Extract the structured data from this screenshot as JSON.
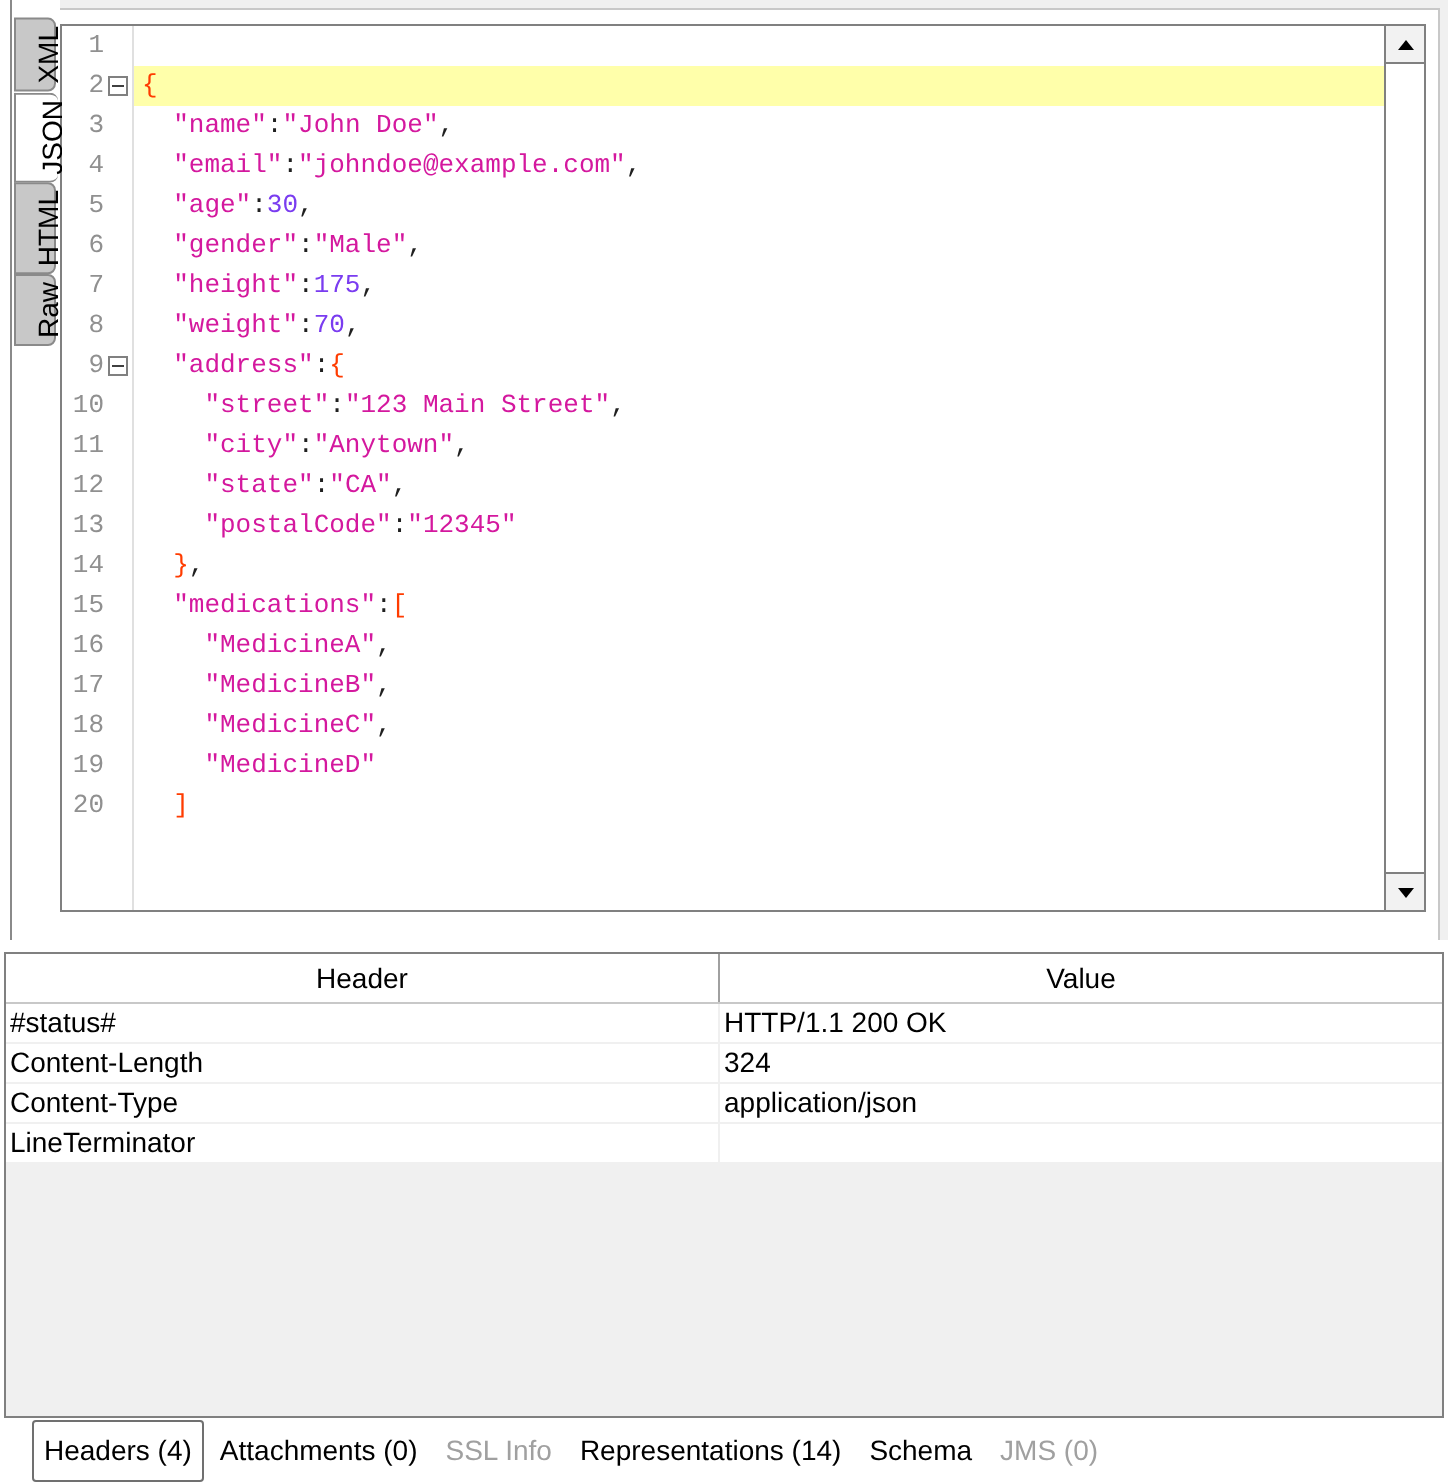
{
  "view_tabs": [
    {
      "label": "XML",
      "selected": false
    },
    {
      "label": "JSON",
      "selected": true
    },
    {
      "label": "HTML",
      "selected": false
    },
    {
      "label": "Raw",
      "selected": false
    }
  ],
  "editor": {
    "lines": [
      {
        "number": "1",
        "highlighted": false
      },
      {
        "number": "2",
        "highlighted": true,
        "expanded": true,
        "tokens": [
          {
            "kind": "brace",
            "text": "{"
          }
        ]
      },
      {
        "number": "3",
        "highlighted": false,
        "tokens": [
          {
            "kind": "string",
            "text": "  \"name\""
          },
          {
            "kind": "punct",
            "text": ":"
          },
          {
            "kind": "string",
            "text": "\"John Doe\""
          },
          {
            "kind": "punct",
            "text": ","
          }
        ]
      },
      {
        "number": "4",
        "highlighted": false,
        "tokens": [
          {
            "kind": "string",
            "text": "  \"email\""
          },
          {
            "kind": "punct",
            "text": ":"
          },
          {
            "kind": "string",
            "text": "\"johndoe@example.com\""
          },
          {
            "kind": "punct",
            "text": ","
          }
        ]
      },
      {
        "number": "5",
        "highlighted": false,
        "tokens": [
          {
            "kind": "string",
            "text": "  \"age\""
          },
          {
            "kind": "punct",
            "text": ":"
          },
          {
            "kind": "number",
            "text": "30"
          },
          {
            "kind": "punct",
            "text": ","
          }
        ]
      },
      {
        "number": "6",
        "highlighted": false,
        "tokens": [
          {
            "kind": "string",
            "text": "  \"gender\""
          },
          {
            "kind": "punct",
            "text": ":"
          },
          {
            "kind": "string",
            "text": "\"Male\""
          },
          {
            "kind": "punct",
            "text": ","
          }
        ]
      },
      {
        "number": "7",
        "highlighted": false,
        "tokens": [
          {
            "kind": "string",
            "text": "  \"height\""
          },
          {
            "kind": "punct",
            "text": ":"
          },
          {
            "kind": "number",
            "text": "175"
          },
          {
            "kind": "punct",
            "text": ","
          }
        ]
      },
      {
        "number": "8",
        "highlighted": false,
        "tokens": [
          {
            "kind": "string",
            "text": "  \"weight\""
          },
          {
            "kind": "punct",
            "text": ":"
          },
          {
            "kind": "number",
            "text": "70"
          },
          {
            "kind": "punct",
            "text": ","
          }
        ]
      },
      {
        "number": "9",
        "highlighted": false,
        "expanded": true,
        "tokens": [
          {
            "kind": "string",
            "text": "  \"address\""
          },
          {
            "kind": "punct",
            "text": ":"
          },
          {
            "kind": "brace",
            "text": "{"
          }
        ]
      },
      {
        "number": "10",
        "highlighted": false,
        "tokens": [
          {
            "kind": "string",
            "text": "    \"street\""
          },
          {
            "kind": "punct",
            "text": ":"
          },
          {
            "kind": "string",
            "text": "\"123 Main Street\""
          },
          {
            "kind": "punct",
            "text": ","
          }
        ]
      },
      {
        "number": "11",
        "highlighted": false,
        "tokens": [
          {
            "kind": "string",
            "text": "    \"city\""
          },
          {
            "kind": "punct",
            "text": ":"
          },
          {
            "kind": "string",
            "text": "\"Anytown\""
          },
          {
            "kind": "punct",
            "text": ","
          }
        ]
      },
      {
        "number": "12",
        "highlighted": false,
        "tokens": [
          {
            "kind": "string",
            "text": "    \"state\""
          },
          {
            "kind": "punct",
            "text": ":"
          },
          {
            "kind": "string",
            "text": "\"CA\""
          },
          {
            "kind": "punct",
            "text": ","
          }
        ]
      },
      {
        "number": "13",
        "highlighted": false,
        "tokens": [
          {
            "kind": "string",
            "text": "    \"postalCode\""
          },
          {
            "kind": "punct",
            "text": ":"
          },
          {
            "kind": "string",
            "text": "\"12345\""
          }
        ]
      },
      {
        "number": "14",
        "highlighted": false,
        "tokens": [
          {
            "kind": "brace",
            "text": "  }"
          },
          {
            "kind": "punct",
            "text": ","
          }
        ]
      },
      {
        "number": "15",
        "highlighted": false,
        "tokens": [
          {
            "kind": "string",
            "text": "  \"medications\""
          },
          {
            "kind": "punct",
            "text": ":"
          },
          {
            "kind": "brace",
            "text": "["
          }
        ]
      },
      {
        "number": "16",
        "highlighted": false,
        "tokens": [
          {
            "kind": "string",
            "text": "    \"MedicineA\""
          },
          {
            "kind": "punct",
            "text": ","
          }
        ]
      },
      {
        "number": "17",
        "highlighted": false,
        "tokens": [
          {
            "kind": "string",
            "text": "    \"MedicineB\""
          },
          {
            "kind": "punct",
            "text": ","
          }
        ]
      },
      {
        "number": "18",
        "highlighted": false,
        "tokens": [
          {
            "kind": "string",
            "text": "    \"MedicineC\""
          },
          {
            "kind": "punct",
            "text": ","
          }
        ]
      },
      {
        "number": "19",
        "highlighted": false,
        "tokens": [
          {
            "kind": "string",
            "text": "    \"MedicineD\""
          }
        ]
      },
      {
        "number": "20",
        "highlighted": false,
        "tokens": [
          {
            "kind": "brace",
            "text": "  ]"
          }
        ]
      }
    ]
  },
  "headers_table": {
    "columns": [
      "Header",
      "Value"
    ],
    "rows": [
      [
        "#status#",
        "HTTP/1.1 200 OK"
      ],
      [
        "Content-Length",
        "324"
      ],
      [
        "Content-Type",
        "application/json"
      ],
      [
        "LineTerminator",
        ""
      ]
    ]
  },
  "bottom_tabs": [
    {
      "label": "Headers (4)",
      "selected": true,
      "disabled": false
    },
    {
      "label": "Attachments (0)",
      "selected": false,
      "disabled": false
    },
    {
      "label": "SSL Info",
      "selected": false,
      "disabled": true
    },
    {
      "label": "Representations (14)",
      "selected": false,
      "disabled": false
    },
    {
      "label": "Schema",
      "selected": false,
      "disabled": false
    },
    {
      "label": "JMS (0)",
      "selected": false,
      "disabled": true
    }
  ]
}
